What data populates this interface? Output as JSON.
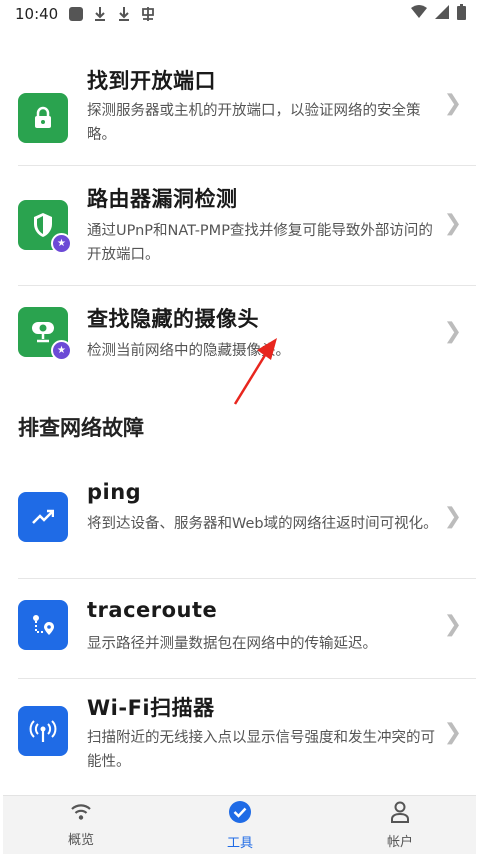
{
  "status_bar": {
    "time": "10:40"
  },
  "items_top": [
    {
      "title": "找到开放端口",
      "desc": "探测服务器或主机的开放端口，以验证网络的安全策略。",
      "icon": "lock-icon",
      "color": "#2aa34f",
      "premium": false
    },
    {
      "title": "路由器漏洞检测",
      "desc": "通过UPnP和NAT-PMP查找并修复可能导致外部访问的开放端口。",
      "icon": "shield-icon",
      "color": "#2aa34f",
      "premium": true
    },
    {
      "title": "查找隐藏的摄像头",
      "desc": "检测当前网络中的隐藏摄像头。",
      "icon": "camera-icon",
      "color": "#2aa34f",
      "premium": true
    }
  ],
  "section_title": "排查网络故障",
  "items_bottom": [
    {
      "title": "ping",
      "desc": "将到达设备、服务器和Web域的网络往返时间可视化。",
      "icon": "trend-icon",
      "color": "#1f6be6"
    },
    {
      "title": "traceroute",
      "desc": "显示路径并测量数据包在网络中的传输延迟。",
      "icon": "route-icon",
      "color": "#1f6be6"
    },
    {
      "title": "Wi-Fi扫描器",
      "desc": "扫描附近的无线接入点以显示信号强度和发生冲突的可能性。",
      "icon": "antenna-icon",
      "color": "#1f6be6"
    }
  ],
  "bottom_nav": [
    {
      "label": "概览",
      "icon": "wifi-icon",
      "active": false
    },
    {
      "label": "工具",
      "icon": "check-circle-icon",
      "active": true
    },
    {
      "label": "帐户",
      "icon": "person-icon",
      "active": false
    }
  ],
  "colors": {
    "accent": "#1f6be6",
    "green": "#2aa34f",
    "premium_badge": "#6c4ad6"
  }
}
